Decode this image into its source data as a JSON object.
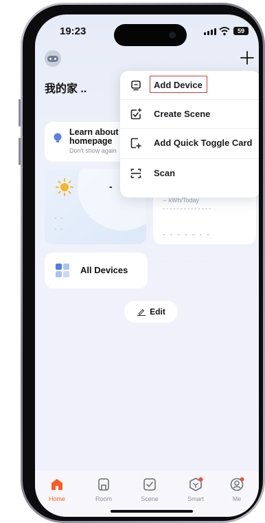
{
  "status_bar": {
    "time": "19:23",
    "battery": "59"
  },
  "header": {
    "home_name": "我的家 .."
  },
  "tip_card": {
    "title": "Learn about DIY homepage",
    "subtitle": "Don't show again"
  },
  "weather_card": {
    "temperature": "-",
    "placeholder_line1": "- -",
    "placeholder_line2": "- -"
  },
  "energy_card": {
    "value_label": "-- kWh/Today",
    "placeholder": "- - - - - - -"
  },
  "devices_card": {
    "label": "All Devices"
  },
  "edit_button": {
    "label": "Edit"
  },
  "add_menu": {
    "items": [
      {
        "label": "Add Device",
        "icon": "add-device-icon",
        "highlighted": true
      },
      {
        "label": "Create Scene",
        "icon": "create-scene-icon"
      },
      {
        "label": "Add Quick Toggle Card",
        "icon": "add-card-icon"
      },
      {
        "label": "Scan",
        "icon": "scan-icon"
      }
    ]
  },
  "tab_bar": {
    "tabs": [
      {
        "label": "Home",
        "icon": "home-icon",
        "active": true
      },
      {
        "label": "Room",
        "icon": "room-icon"
      },
      {
        "label": "Scene",
        "icon": "scene-icon"
      },
      {
        "label": "Smart",
        "icon": "smart-icon",
        "badge": true
      },
      {
        "label": "Me",
        "icon": "me-icon",
        "badge": true
      }
    ]
  },
  "colors": {
    "accent": "#ff5a1f",
    "highlight_box": "#d33a3a",
    "badge": "#ff4d2e"
  }
}
